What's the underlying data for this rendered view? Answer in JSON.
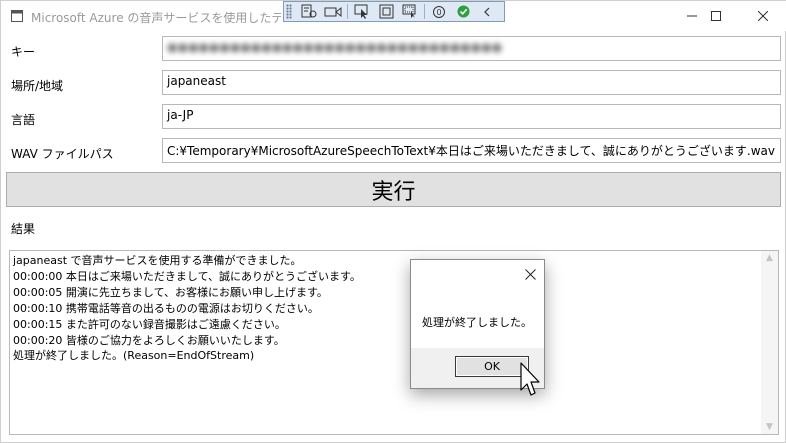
{
  "window": {
    "title": "Microsoft Azure の音声サービスを使用したテキスト化",
    "controls": {
      "minimize_icon": "minimize-icon",
      "maximize_icon": "maximize-icon",
      "close_icon": "close-icon"
    }
  },
  "debug_toolbar": {
    "items": [
      "live-visual-tree-icon",
      "video-icon",
      "select-element-icon",
      "display-layout-adorners-icon",
      "track-focus-icon",
      "binding-failures-icon",
      "hot-reload-check-icon",
      "collapse-icon"
    ]
  },
  "form": {
    "key": {
      "label": "キー",
      "value": "●●●●●●●●●●●●●●●●●●●●●●●●●●●●●●●●"
    },
    "region": {
      "label": "場所/地域",
      "value": "japaneast"
    },
    "language": {
      "label": "言語",
      "value": "ja-JP"
    },
    "wav_path": {
      "label": "WAV ファイルパス",
      "value": "C:¥Temporary¥MicrosoftAzureSpeechToText¥本日はご来場いただきまして、誠にありがとうございます.wav"
    }
  },
  "run_button": {
    "label": "実行"
  },
  "results": {
    "label": "結果",
    "lines": [
      "japaneast で音声サービスを使用する準備ができました。",
      "00:00:00 本日はご来場いただきまして、誠にありがとうございます。",
      "00:00:05 開演に先立ちまして、お客様にお願い申し上げます。",
      "00:00:10 携帯電話等音の出るものの電源はお切りください。",
      "00:00:15 また許可のない録音撮影はご遠慮ください。",
      "00:00:20 皆様のご協力をよろしくお願いいたします。",
      "処理が終了しました。(Reason=EndOfStream)"
    ]
  },
  "dialog": {
    "message": "処理が終了しました。",
    "ok_label": "OK"
  },
  "colors": {
    "button_bg": "#e1e1e1",
    "border": "#b8b8b8",
    "toolbar_bg": "#dfe8f5"
  }
}
